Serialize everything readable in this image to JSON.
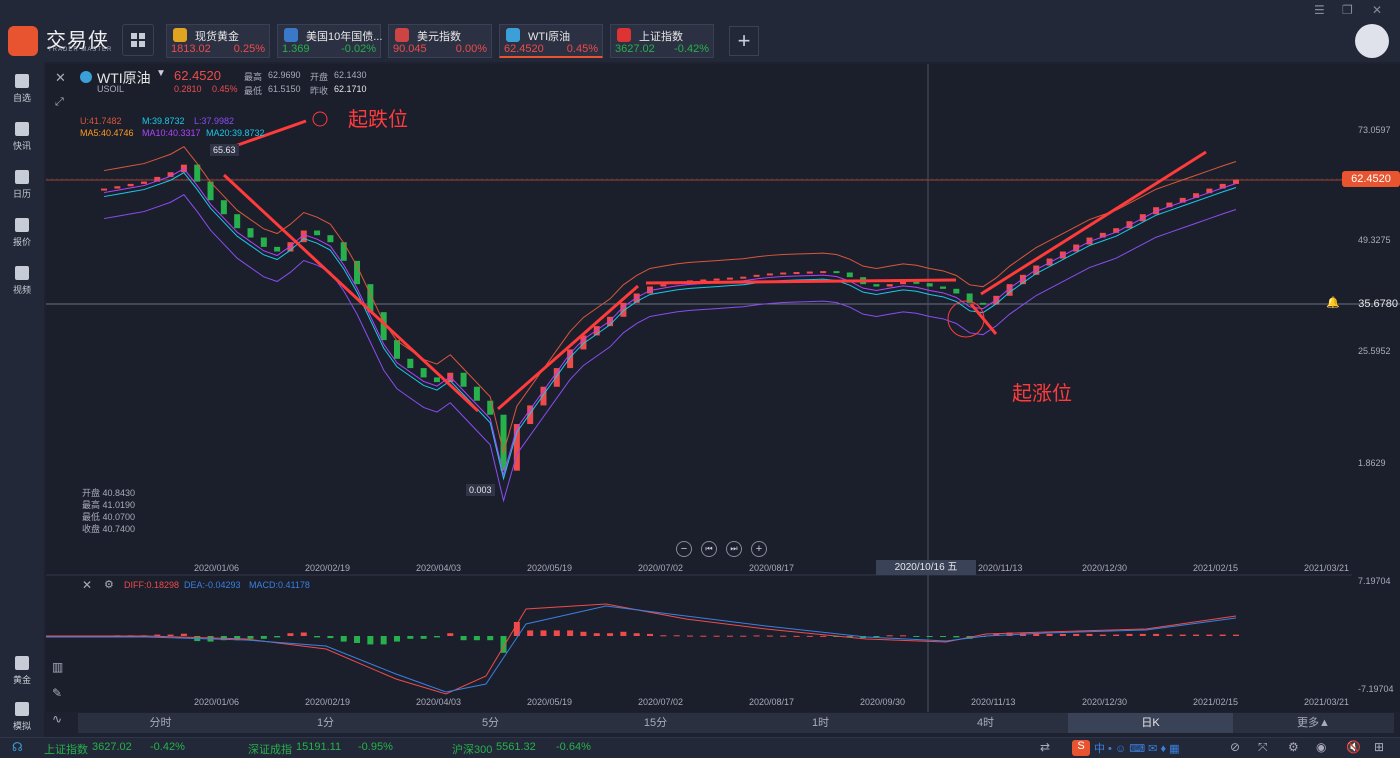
{
  "app": {
    "name": "交易侠",
    "tagline": "TRADER MASTER"
  },
  "tickers": [
    {
      "name": "现货黄金",
      "price": "1813.02",
      "change": "0.25%",
      "dir": "up"
    },
    {
      "name": "美国10年国债...",
      "price": "1.369",
      "change": "-0.02%",
      "dir": "dn"
    },
    {
      "name": "美元指数",
      "price": "90.045",
      "change": "0.00%",
      "dir": "up"
    },
    {
      "name": "WTI原油",
      "price": "62.4520",
      "change": "0.45%",
      "dir": "up"
    },
    {
      "name": "上证指数",
      "price": "3627.02",
      "change": "-0.42%",
      "dir": "dn"
    }
  ],
  "sidebar": [
    {
      "label": "自选",
      "icon": "bookmark-icon"
    },
    {
      "label": "快讯",
      "icon": "news-icon"
    },
    {
      "label": "日历",
      "icon": "calendar-icon"
    },
    {
      "label": "报价",
      "icon": "quote-chart-icon"
    },
    {
      "label": "视频",
      "icon": "video-icon"
    },
    {
      "label": "黄金",
      "icon": "gold-icon"
    },
    {
      "label": "模拟",
      "icon": "wallet-icon"
    }
  ],
  "symbol": {
    "name": "WTI原油",
    "code": "USOIL",
    "price": "62.4520",
    "chg": "0.2810",
    "chg_pct": "0.45%",
    "high_label": "最高",
    "high": "62.9690",
    "open_label": "开盘",
    "open": "62.1430",
    "low_label": "最低",
    "low": "61.5150",
    "prev_label": "昨收",
    "prev": "62.1710"
  },
  "boll": {
    "u": "U:41.7482",
    "m": "M:39.8732",
    "l": "L:37.9982"
  },
  "ma": {
    "ma5": "MA5:40.4746",
    "ma10": "MA10:40.3317",
    "ma20": "MA20:39.8732"
  },
  "ohlc_box": {
    "open": "开盘 40.8430",
    "high": "最高 41.0190",
    "low": "最低 40.0700",
    "close": "收盘 40.7400"
  },
  "price_axis": [
    "73.0597",
    "49.3275",
    "25.5952",
    "1.8629"
  ],
  "price_tags": {
    "last": "62.4520",
    "crosshair": "35.6780",
    "peak": "65.63",
    "trough": "0.003"
  },
  "annotations": {
    "drop": "起跌位",
    "rise": "起涨位"
  },
  "dates": [
    "2020/01/06",
    "2020/02/19",
    "2020/04/03",
    "2020/05/19",
    "2020/07/02",
    "2020/08/17",
    "2020/09/30",
    "2020/11/13",
    "2020/12/30",
    "2021/02/15",
    "2021/03/21"
  ],
  "cursor_date": "2020/10/16 五",
  "macd": {
    "diff": "DIFF:0.18298",
    "dea": "DEA:-0.04293",
    "macd": "MACD:0.41178",
    "axis_top": "7.19704",
    "axis_bot": "-7.19704"
  },
  "timeframes": [
    "分时",
    "1分",
    "5分",
    "15分",
    "1时",
    "4时",
    "日K",
    "更多▲"
  ],
  "active_timeframe": "日K",
  "status": [
    {
      "name": "上证指数",
      "value": "3627.02",
      "chg": "-0.42%"
    },
    {
      "name": "深证成指",
      "value": "15191.11",
      "chg": "-0.95%"
    },
    {
      "name": "沪深300",
      "value": "5561.32",
      "chg": "-0.64%"
    }
  ],
  "colors": {
    "up": "#ef4b4b",
    "down": "#26b14c",
    "ma5": "#ff9a1f",
    "ma10": "#b042ff",
    "ma20": "#18c9e8",
    "boll_u": "#d9573a",
    "boll_l": "#8b4cf0",
    "accent": "#e8542f"
  },
  "chart_data": {
    "type": "candlestick",
    "series": [
      {
        "name": "WTI原油",
        "values": [
          60.5,
          61.0,
          61.5,
          62.0,
          63.0,
          64.0,
          65.63,
          62.0,
          58.0,
          55.0,
          52.0,
          50.0,
          48.0,
          47.0,
          49.0,
          51.5,
          50.5,
          49.0,
          45.0,
          40.0,
          34.0,
          28.0,
          24.0,
          22.0,
          20.0,
          19.0,
          21.0,
          18.0,
          15.0,
          12.0,
          0.003,
          10.0,
          14.0,
          18.0,
          22.0,
          26.0,
          29.0,
          31.0,
          33.0,
          36.0,
          38.0,
          39.5,
          40.0,
          40.5,
          40.8,
          41.0,
          41.2,
          41.4,
          41.6,
          42.0,
          42.3,
          42.5,
          42.6,
          42.7,
          42.8,
          42.5,
          41.5,
          40.0,
          39.5,
          40.0,
          40.5,
          40.2,
          39.5,
          39.0,
          38.0,
          36.0,
          35.6,
          37.5,
          40.0,
          42.0,
          44.0,
          45.5,
          47.0,
          48.5,
          50.0,
          51.0,
          52.0,
          53.5,
          55.0,
          56.5,
          57.5,
          58.5,
          59.5,
          60.5,
          61.5,
          62.452
        ]
      }
    ],
    "ylim": [
      1.8629,
      73.0597
    ]
  }
}
